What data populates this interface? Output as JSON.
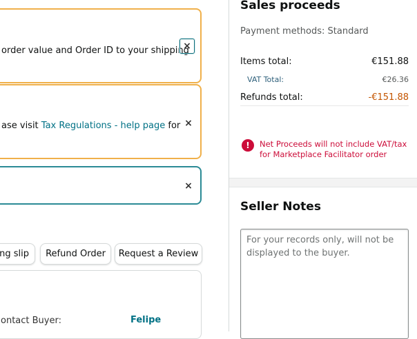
{
  "alerts": [
    {
      "text": "order value and Order ID to your shipping"
    },
    {
      "text_before": "ase visit ",
      "link": "Tax Regulations - help page",
      "text_after": " for"
    },
    {
      "text": ""
    }
  ],
  "close_glyph": "×",
  "actions": {
    "packing_slip": "ing slip",
    "refund_order": "Refund Order",
    "request_review": "Request a Review"
  },
  "buyer": {
    "label": "ontact Buyer:",
    "name": "Felipe"
  },
  "sales": {
    "title": "Sales proceeds",
    "payment_methods": "Payment methods: Standard",
    "items_total_label": "Items total:",
    "items_total_value": "€151.88",
    "vat_label": "VAT Total:",
    "vat_value": "€26.36",
    "refunds_label": "Refunds total:",
    "refunds_value": "-€151.88",
    "notice_icon": "!",
    "notice": "Net Proceeds will not include VAT/tax for Marketplace Facilitator order"
  },
  "seller_notes": {
    "title": "Seller Notes",
    "placeholder": "For your records only, will not be displayed to the buyer."
  },
  "colors": {
    "warning_border": "#f0b04a",
    "info_border": "#2a8a95",
    "link": "#007185",
    "negative": "#c45500",
    "error": "#cc0c39"
  }
}
